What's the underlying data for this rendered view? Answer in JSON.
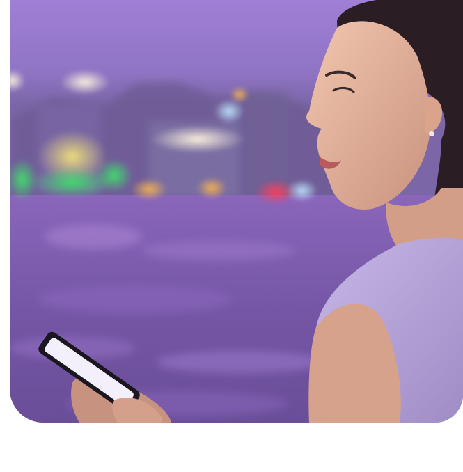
{
  "photo": {
    "subject": "woman-with-smartphone-at-night-harbor",
    "palette": {
      "sky_top": "#9a7ad0",
      "sky_bottom": "#8a72b8",
      "water": "#7a5aa8",
      "water_dark": "#5d4486",
      "skin": "#e8b49a",
      "hair": "#2a1c22",
      "dress": "#b9a6d8"
    }
  }
}
